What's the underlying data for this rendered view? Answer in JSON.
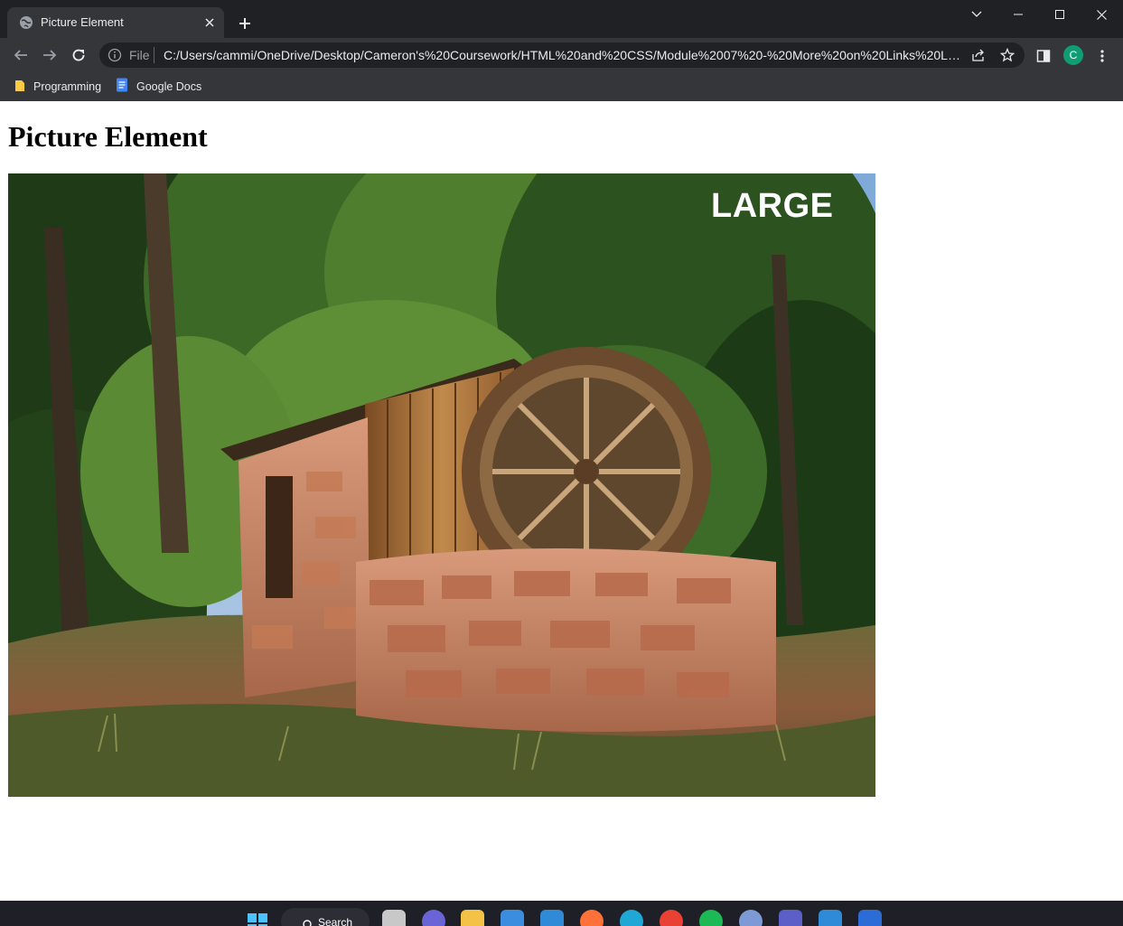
{
  "browser": {
    "tab": {
      "title": "Picture Element"
    },
    "address_bar": {
      "scheme_label": "File",
      "url": "C:/Users/cammi/OneDrive/Desktop/Cameron's%20Coursework/HTML%20and%20CSS/Module%2007%20-%20More%20on%20Links%20Layo..."
    },
    "profile_initial": "C",
    "bookmarks": [
      {
        "label": "Programming",
        "icon": "folder-icon"
      },
      {
        "label": "Google Docs",
        "icon": "google-docs-icon"
      }
    ]
  },
  "page": {
    "heading": "Picture Element",
    "picture": {
      "overlay_text": "LARGE"
    }
  },
  "taskbar": {
    "search_label": "Search",
    "apps": [
      "windows-start-icon",
      "task-view-icon",
      "teams-chat-icon",
      "file-explorer-icon",
      "microsoft-store-icon",
      "app-icon",
      "firefox-icon",
      "edge-icon",
      "chrome-icon",
      "spotify-icon",
      "r-icon",
      "teams-icon",
      "vscode-icon",
      "word-icon"
    ]
  },
  "colors": {
    "chrome_bg": "#35363a",
    "tabstrip_bg": "#202124",
    "taskbar_bg": "#1f1f28",
    "avatar_bg": "#0f9d74"
  }
}
